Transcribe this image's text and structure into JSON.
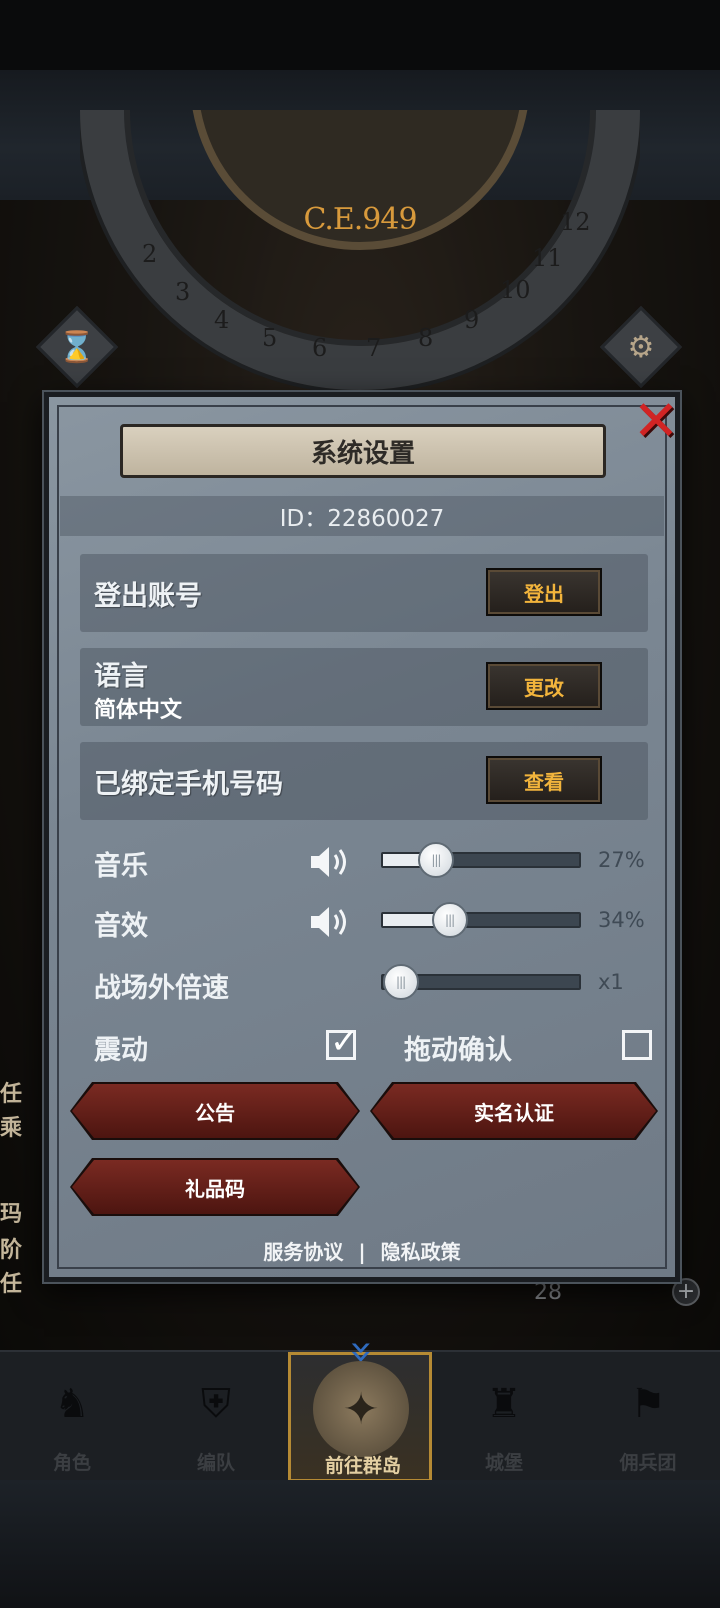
{
  "hud": {
    "year_label": "C.E.949",
    "dial_numbers": [
      "2",
      "3",
      "4",
      "5",
      "6",
      "7",
      "8",
      "9",
      "10",
      "11",
      "12"
    ],
    "gem_count": "28",
    "left_fragments": [
      "任",
      "乘",
      "玛",
      "阶",
      "任"
    ]
  },
  "dialog": {
    "title": "系统设置",
    "id_label": "ID：22860027",
    "rows": [
      {
        "label": "登出账号",
        "button": "登出"
      },
      {
        "label": "语言",
        "sublabel": "简体中文",
        "button": "更改"
      },
      {
        "label": "已绑定手机号码",
        "button": "查看"
      }
    ],
    "sliders": [
      {
        "label": "音乐",
        "value": 27,
        "value_text": "27%",
        "has_speaker": true
      },
      {
        "label": "音效",
        "value": 34,
        "value_text": "34%",
        "has_speaker": true
      },
      {
        "label": "战场外倍速",
        "value": 0,
        "value_text": "x1",
        "has_speaker": false
      }
    ],
    "toggles": [
      {
        "label": "震动",
        "checked": true
      },
      {
        "label": "拖动确认",
        "checked": false
      }
    ],
    "buttons": {
      "announcement": "公告",
      "real_name": "实名认证",
      "gift_code": "礼品码"
    },
    "footer": {
      "terms": "服务协议",
      "separator": "|",
      "privacy": "隐私政策"
    }
  },
  "nav": [
    {
      "label": "角色",
      "icon": "knight-icon",
      "active": false
    },
    {
      "label": "编队",
      "icon": "helmet-icon",
      "active": false
    },
    {
      "label": "前往群岛",
      "icon": "island-compass-icon",
      "active": true
    },
    {
      "label": "城堡",
      "icon": "castle-icon",
      "active": false
    },
    {
      "label": "佣兵团",
      "icon": "mercenary-icon",
      "active": false
    }
  ],
  "colors": {
    "accent_gold": "#f2b43c",
    "close_red": "#d12424",
    "button_red": "#7a2a22",
    "active_nav_border": "#b58a34"
  }
}
